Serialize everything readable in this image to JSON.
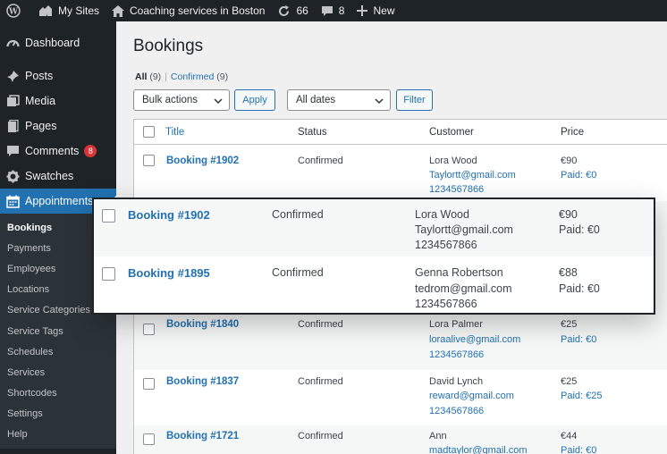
{
  "adminbar": {
    "my_sites": "My Sites",
    "site_name": "Coaching services in Boston",
    "updates": "66",
    "comments": "8",
    "new": "New"
  },
  "sidebar": {
    "items": [
      {
        "label": "Dashboard",
        "icon": "dashboard-icon"
      },
      {
        "label": "Posts",
        "icon": "pin-icon"
      },
      {
        "label": "Media",
        "icon": "media-icon"
      },
      {
        "label": "Pages",
        "icon": "pages-icon"
      },
      {
        "label": "Comments",
        "icon": "comment-icon",
        "badge": "8"
      },
      {
        "label": "Swatches",
        "icon": "gear-icon"
      },
      {
        "label": "Appointments",
        "icon": "calendar-icon"
      }
    ],
    "submenu": [
      "Bookings",
      "Payments",
      "Employees",
      "Locations",
      "Service Categories",
      "Service Tags",
      "Schedules",
      "Services",
      "Shortcodes",
      "Settings",
      "Help"
    ]
  },
  "main": {
    "title": "Bookings",
    "filters": {
      "all": "All",
      "all_count": "(9)",
      "separator": "|",
      "confirmed": "Confirmed",
      "confirmed_count": "(9)"
    },
    "bulk_actions": "Bulk actions",
    "apply": "Apply",
    "dates": "All dates",
    "filter": "Filter"
  },
  "table": {
    "columns": [
      "Title",
      "Status",
      "Customer",
      "Price"
    ],
    "rows": [
      {
        "title": "Booking #1902",
        "status": "Confirmed",
        "name": "Lora Wood",
        "email": "Taylortt@gmail.com",
        "phone": "1234567866",
        "price": "€90",
        "paid": "Paid: €0"
      },
      {
        "title": "Booking #1840",
        "status": "Confirmed",
        "name": "Lora Palmer",
        "email": "loraalive@gmail.com",
        "phone": "1234567866",
        "price": "€25",
        "paid": "Paid: €0"
      },
      {
        "title": "Booking #1837",
        "status": "Confirmed",
        "name": "David Lynch",
        "email": "reward@gmail.com",
        "phone": "1234567866",
        "price": "€25",
        "paid": "Paid: €25"
      },
      {
        "title": "Booking #1721",
        "status": "Confirmed",
        "name": "Ann",
        "email": "madtaylor@gmail.com",
        "price": "€44",
        "paid": "Paid: €0"
      }
    ]
  },
  "zoom": {
    "rows": [
      {
        "title": "Booking #1902",
        "status": "Confirmed",
        "name": "Lora Wood",
        "email": "Taylortt@gmail.com",
        "phone": "1234567866",
        "price": "€90",
        "paid": "Paid: €0"
      },
      {
        "title": "Booking #1895",
        "status": "Confirmed",
        "name": "Genna Robertson",
        "email": "tedrom@gmail.com",
        "phone": "1234567866",
        "price": "€88",
        "paid": "Paid: €0"
      }
    ]
  },
  "colors": {
    "accent": "#2271b1",
    "adminbar": "#1d2327",
    "badge": "#d63638"
  }
}
